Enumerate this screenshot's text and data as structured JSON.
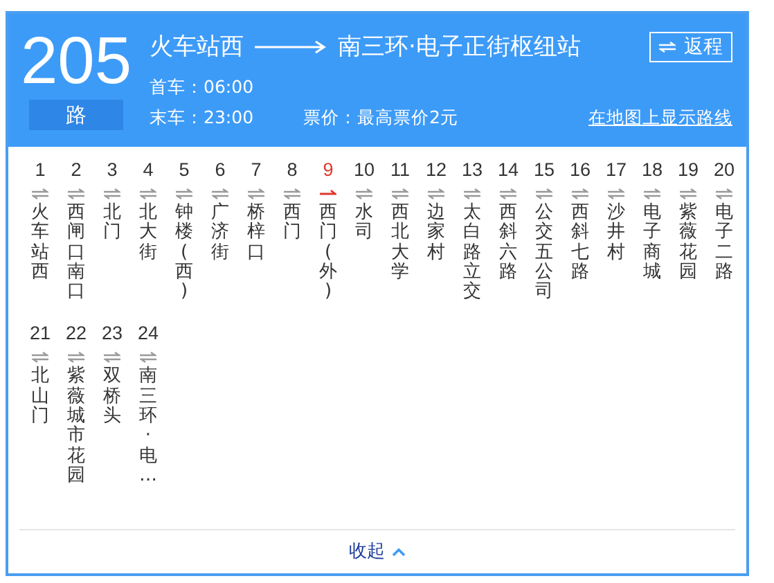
{
  "route": {
    "number": "205",
    "suffix": "路",
    "origin": "火车站西",
    "destination": "南三环·电子正街枢纽站",
    "first_bus": "首车：06:00",
    "last_bus": "末车：23:00",
    "fare": "票价：最高票价2元",
    "return_button": "返程",
    "map_link": "在地图上显示路线"
  },
  "stations": [
    {
      "index": "1",
      "name": "火车站西",
      "selected": false
    },
    {
      "index": "2",
      "name": "西闸口南口",
      "selected": false
    },
    {
      "index": "3",
      "name": "北门",
      "selected": false
    },
    {
      "index": "4",
      "name": "北大街",
      "selected": false
    },
    {
      "index": "5",
      "name": "钟楼(西)",
      "selected": false
    },
    {
      "index": "6",
      "name": "广济街",
      "selected": false
    },
    {
      "index": "7",
      "name": "桥梓口",
      "selected": false
    },
    {
      "index": "8",
      "name": "西门",
      "selected": false
    },
    {
      "index": "9",
      "name": "西门(外)",
      "selected": true
    },
    {
      "index": "10",
      "name": "水司",
      "selected": false
    },
    {
      "index": "11",
      "name": "西北大学",
      "selected": false
    },
    {
      "index": "12",
      "name": "边家村",
      "selected": false
    },
    {
      "index": "13",
      "name": "太白路立交",
      "selected": false
    },
    {
      "index": "14",
      "name": "西斜六路",
      "selected": false
    },
    {
      "index": "15",
      "name": "公交五公司",
      "selected": false
    },
    {
      "index": "16",
      "name": "西斜七路",
      "selected": false
    },
    {
      "index": "17",
      "name": "沙井村",
      "selected": false
    },
    {
      "index": "18",
      "name": "电子商城",
      "selected": false
    },
    {
      "index": "19",
      "name": "紫薇花园",
      "selected": false
    },
    {
      "index": "20",
      "name": "电子二路",
      "selected": false
    },
    {
      "index": "21",
      "name": "北山门",
      "selected": false
    },
    {
      "index": "22",
      "name": "紫薇城市花园",
      "selected": false
    },
    {
      "index": "23",
      "name": "双桥头",
      "selected": false
    },
    {
      "index": "24",
      "name": "南三环·电…",
      "selected": false
    }
  ],
  "collapse_button": "收起"
}
